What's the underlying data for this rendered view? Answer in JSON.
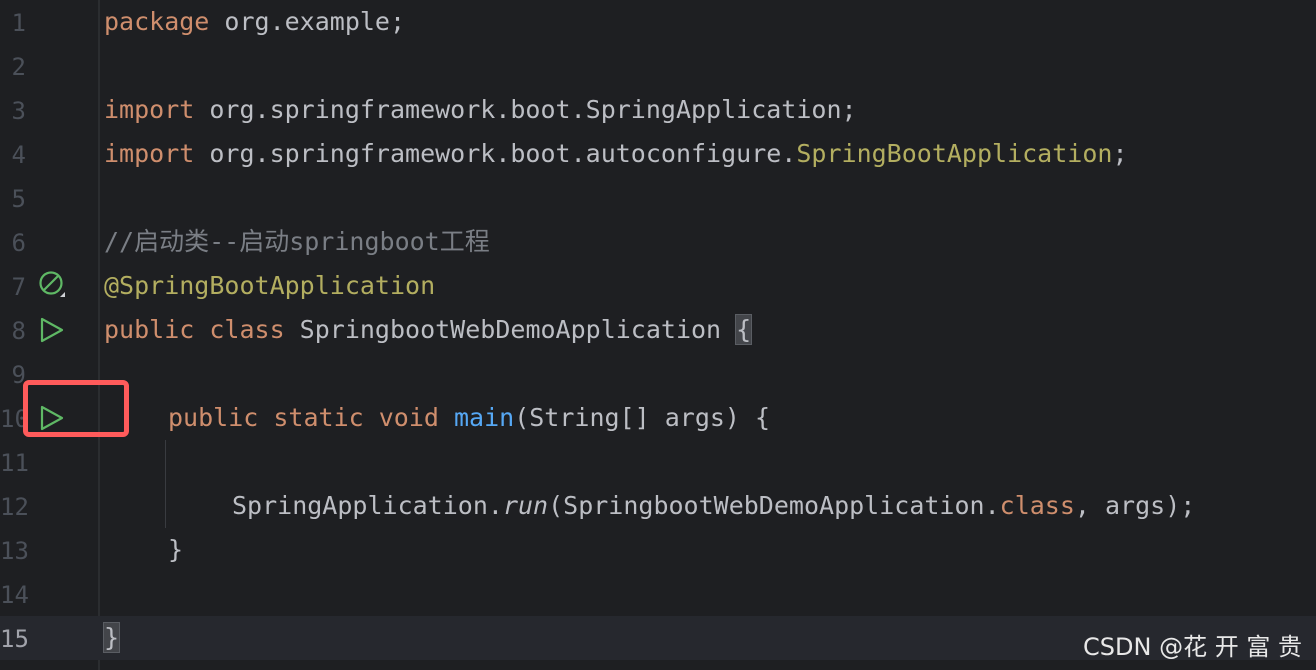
{
  "lines": [
    {
      "n": "1",
      "tokens": [
        {
          "t": "package ",
          "c": "kw"
        },
        {
          "t": "org.example;",
          "c": ""
        }
      ]
    },
    {
      "n": "2",
      "tokens": []
    },
    {
      "n": "3",
      "tokens": [
        {
          "t": "import ",
          "c": "kw"
        },
        {
          "t": "org.springframework.boot.SpringApplication;",
          "c": ""
        }
      ]
    },
    {
      "n": "4",
      "tokens": [
        {
          "t": "import ",
          "c": "kw"
        },
        {
          "t": "org.springframework.boot.autoconfigure.",
          "c": ""
        },
        {
          "t": "SpringBootApplication",
          "c": "ann"
        },
        {
          "t": ";",
          "c": ""
        }
      ]
    },
    {
      "n": "5",
      "tokens": []
    },
    {
      "n": "6",
      "tokens": [
        {
          "t": "//启动类--启动springboot工程",
          "c": "cmt"
        }
      ]
    },
    {
      "n": "7",
      "tokens": [
        {
          "t": "@SpringBootApplication",
          "c": "ann"
        }
      ]
    },
    {
      "n": "8",
      "tokens": [
        {
          "t": "public ",
          "c": "kw"
        },
        {
          "t": "class ",
          "c": "kw"
        },
        {
          "t": "SpringbootWebDemoApplication ",
          "c": ""
        },
        {
          "t": "{",
          "c": "brace"
        }
      ]
    },
    {
      "n": "9",
      "tokens": []
    },
    {
      "n": "10",
      "tokens": [
        {
          "t": "public ",
          "c": "kw"
        },
        {
          "t": "static ",
          "c": "kw"
        },
        {
          "t": "void ",
          "c": "kw"
        },
        {
          "t": "main",
          "c": "fn"
        },
        {
          "t": "(String[] args) {",
          "c": ""
        }
      ]
    },
    {
      "n": "11",
      "tokens": []
    },
    {
      "n": "12",
      "tokens": [
        {
          "t": "SpringApplication.",
          "c": ""
        },
        {
          "t": "run",
          "c": "it"
        },
        {
          "t": "(SpringbootWebDemoApplication.",
          "c": ""
        },
        {
          "t": "class",
          "c": "kw"
        },
        {
          "t": ", args);",
          "c": ""
        }
      ]
    },
    {
      "n": "13",
      "tokens": [
        {
          "t": "}",
          "c": ""
        }
      ]
    },
    {
      "n": "14",
      "tokens": []
    },
    {
      "n": "15",
      "tokens": [
        {
          "t": "}",
          "c": "brace"
        }
      ]
    }
  ],
  "gutter_icons": [
    {
      "line": "7",
      "icon": "bean-disabled-icon"
    },
    {
      "line": "8",
      "icon": "run-icon"
    },
    {
      "line": "10",
      "icon": "run-icon"
    }
  ],
  "colors": {
    "background": "#1e1f22",
    "keyword": "#cf8e6d",
    "annotation": "#b3ae60",
    "comment": "#7a7e85",
    "function": "#56a8f5",
    "run_icon": "#5fb865",
    "highlight_box": "#ff5b5b"
  },
  "watermark": "CSDN @花 开 富 贵"
}
